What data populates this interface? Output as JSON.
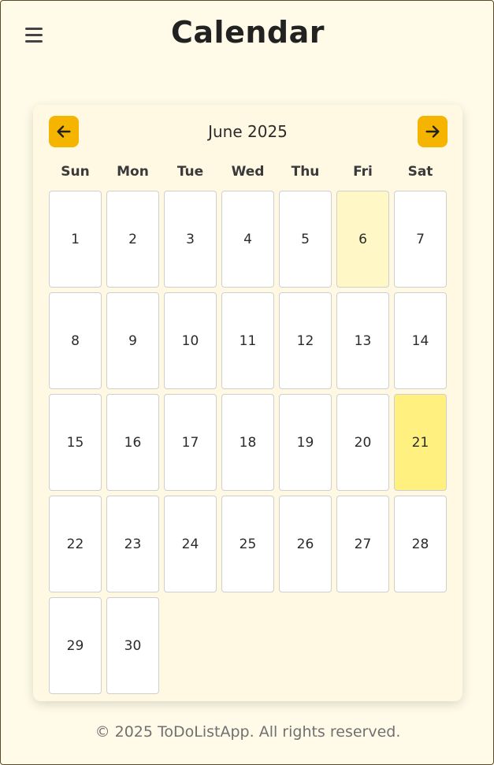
{
  "header": {
    "title": "Calendar",
    "menu_icon": "hamburger-menu-icon"
  },
  "calendar": {
    "month_label": "June 2025",
    "prev_icon": "arrow-left-icon",
    "next_icon": "arrow-right-icon",
    "accent_color": "#f4b400",
    "weekdays": [
      "Sun",
      "Mon",
      "Tue",
      "Wed",
      "Thu",
      "Fri",
      "Sat"
    ],
    "first_weekday_index": 0,
    "days": [
      "1",
      "2",
      "3",
      "4",
      "5",
      "6",
      "7",
      "8",
      "9",
      "10",
      "11",
      "12",
      "13",
      "14",
      "15",
      "16",
      "17",
      "18",
      "19",
      "20",
      "21",
      "22",
      "23",
      "24",
      "25",
      "26",
      "27",
      "28",
      "29",
      "30"
    ],
    "today": "6",
    "selected": "21",
    "today_color": "#fff8c6",
    "selected_color": "#fff080"
  },
  "footer": {
    "text": "© 2025 ToDoListApp. All rights reserved."
  }
}
